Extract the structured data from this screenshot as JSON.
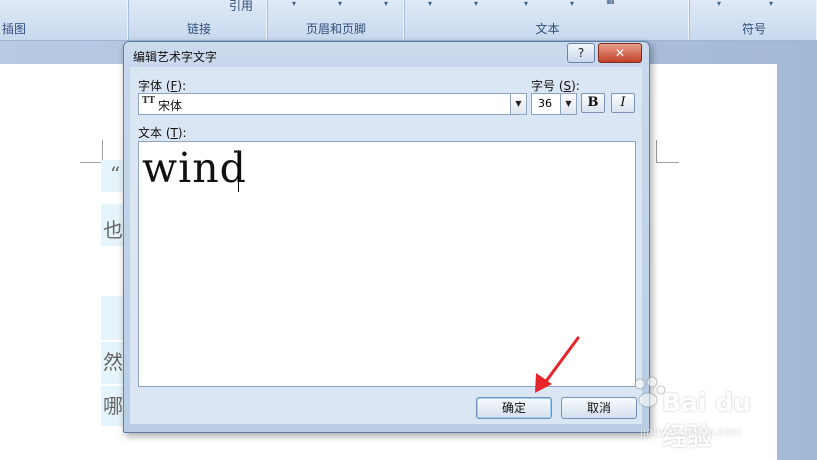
{
  "ribbon": {
    "groups": [
      {
        "label": "插图"
      },
      {
        "label": "链接",
        "top_text": "引用"
      },
      {
        "label": "页眉和页脚"
      },
      {
        "label": "文本"
      },
      {
        "label": "符号"
      }
    ]
  },
  "document": {
    "visible_chars": [
      "“",
      "也",
      "然",
      "哪"
    ]
  },
  "dialog": {
    "title": "编辑艺术字文字",
    "help_btn": "?",
    "close_btn": "✕",
    "font_label_pre": "字体 (",
    "font_label_key": "F",
    "font_label_post": "):",
    "font_value": "宋体",
    "font_icon": "TT",
    "size_label_pre": "字号 (",
    "size_label_key": "S",
    "size_label_post": "):",
    "size_value": "36",
    "bold_label": "B",
    "italic_label": "I",
    "text_label_pre": "文本 (",
    "text_label_key": "T",
    "text_label_post": "):",
    "text_value": "wind",
    "ok_label": "确定",
    "cancel_label": "取消"
  },
  "watermark": {
    "main": "Bai du 经验",
    "sub": "jingyan.baidu.com"
  },
  "colors": {
    "annotation_arrow": "#e8242b",
    "dialog_bg": "#dbe6f4"
  }
}
